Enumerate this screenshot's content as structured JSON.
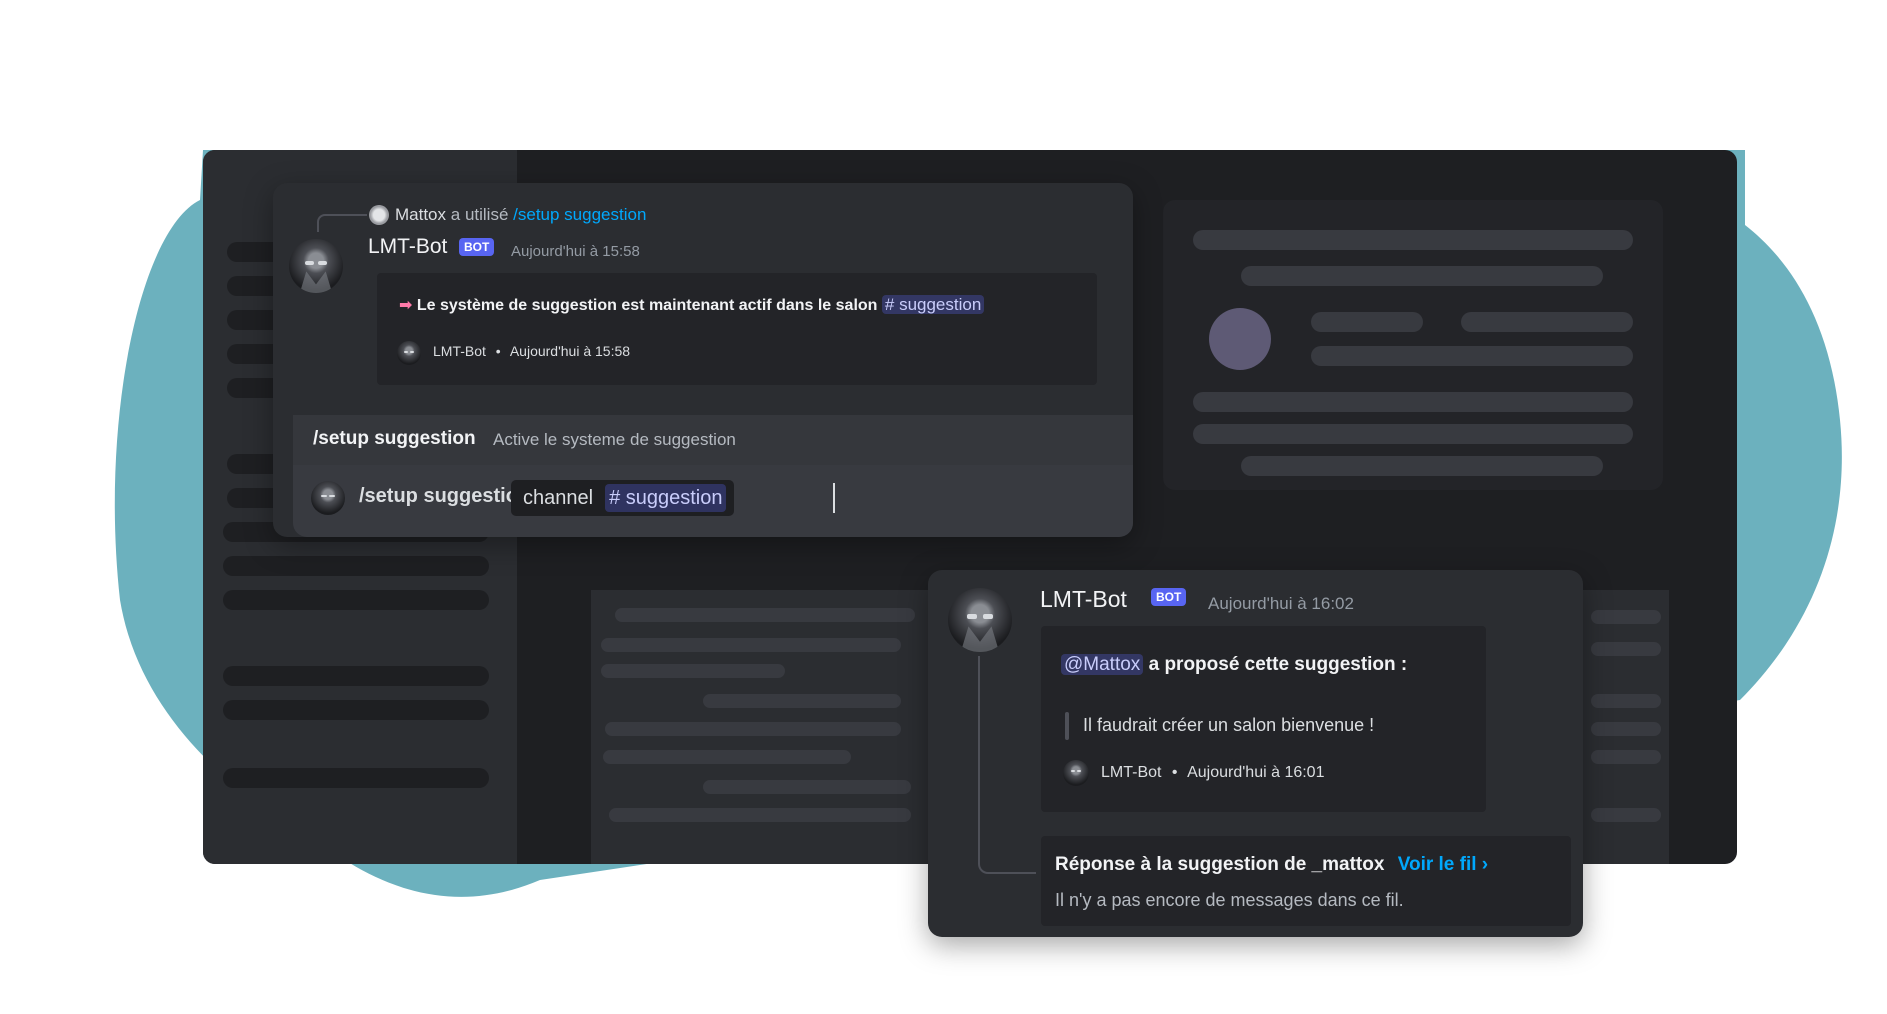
{
  "colors": {
    "accent": "#5865f2",
    "blob": "#6cb1be",
    "link": "#00a8fc",
    "background": "#1e1f22"
  },
  "command_card": {
    "reply_user": "Mattox",
    "reply_text": "a utilisé",
    "reply_command": "/setup suggestion",
    "bot_name": "LMT-Bot",
    "bot_badge": "BOT",
    "timestamp": "Aujourd'hui à 15:58",
    "embed": {
      "arrow_icon": "right-arrow-emoji",
      "text": "Le système de suggestion est maintenant actif dans le salon",
      "channel": "# suggestion",
      "footer_name": "LMT-Bot",
      "footer_time": "Aujourd'hui à 15:58"
    },
    "autocomplete": {
      "command": "/setup suggestion",
      "description": "Active le systeme de suggestion"
    },
    "input": {
      "command": "/setup suggestion",
      "option_name": "channel",
      "option_value": "# suggestion"
    }
  },
  "suggestion_card": {
    "bot_name": "LMT-Bot",
    "bot_badge": "BOT",
    "timestamp": "Aujourd'hui à 16:02",
    "embed": {
      "mention": "@Mattox",
      "title_rest": "a proposé cette suggestion :",
      "quote": "Il faudrait créer un salon bienvenue !",
      "footer_name": "LMT-Bot",
      "footer_time": "Aujourd'hui à 16:01"
    },
    "thread": {
      "title": "Réponse à la suggestion de _mattox",
      "link": "Voir le fil ›",
      "empty_text": "Il n'y a pas encore de messages dans ce fil."
    }
  }
}
